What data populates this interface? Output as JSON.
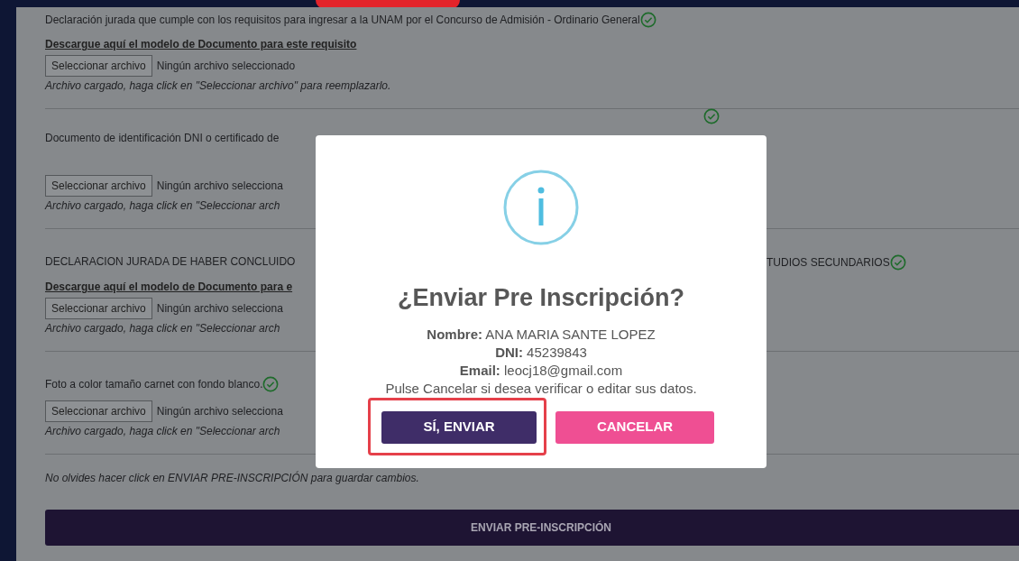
{
  "sections": [
    {
      "title": "Declaración jurada que cumple con los requisitos para ingresar a la UNAM por el Concurso de Admisión - Ordinario General",
      "verified": true,
      "download_link": "Descargue aquí el modelo de Documento para este requisito",
      "file_button": "Seleccionar archivo",
      "file_status": "Ningún archivo seleccionado",
      "note": "Archivo cargado, haga click en \"Seleccionar archivo\" para reemplazarlo."
    },
    {
      "title": "Documento de identificación DNI o certificado de",
      "verified": true,
      "file_button": "Seleccionar archivo",
      "file_status": "Ningún archivo selecciona",
      "note": "Archivo cargado, haga click en \"Seleccionar arch"
    },
    {
      "title": "DECLARACION JURADA DE HABER CONCLUIDO",
      "title_end": "TUDIOS SECUNDARIOS",
      "verified": true,
      "download_link": "Descargue aquí el modelo de Documento para e",
      "file_button": "Seleccionar archivo",
      "file_status": "Ningún archivo selecciona",
      "note": "Archivo cargado, haga click en \"Seleccionar arch"
    },
    {
      "title": "Foto a color tamaño carnet con fondo blanco.",
      "verified": true,
      "file_button": "Seleccionar archivo",
      "file_status": "Ningún archivo selecciona",
      "note": "Archivo cargado, haga click en \"Seleccionar arch"
    }
  ],
  "reminder": "No olvides hacer click en ENVIAR PRE-INSCRIPCIÓN para guardar cambios.",
  "submit_button": "ENVIAR PRE-INSCRIPCIÓN",
  "dialog": {
    "title": "¿Enviar Pre Inscripción?",
    "lines": [
      "**Nombre:** ANA MARIA SANTE LOPEZ",
      "**DNI:** 45239843",
      "**Email:** leocj18@gmail.com",
      "Pulse Cancelar si desea verificar o editar sus datos."
    ],
    "buttons": [
      {
        "label": "SÍ, ENVIAR",
        "kind": "confirm",
        "highlighted": true
      },
      {
        "label": "CANCELAR",
        "kind": "cancel",
        "highlighted": false
      }
    ]
  }
}
